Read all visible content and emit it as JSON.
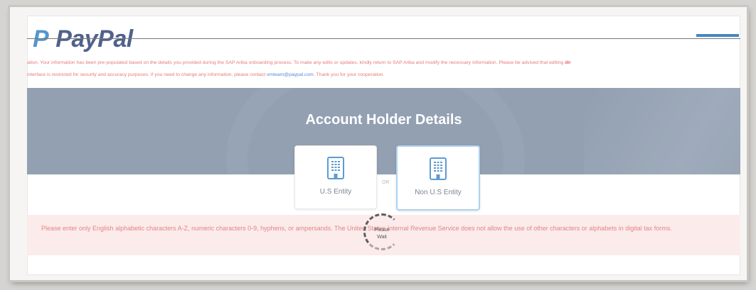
{
  "header": {
    "logo_text": "PayPal"
  },
  "notice": {
    "text_part1": "ation. Your information has been pre-populated based on the details you provided during the SAP Ariba onboarding process. To make any edits or updates, kindly return to SAP Ariba and modify the necessary information. Please be advised that editing",
    "text_strong": "dir",
    "text_part2": "interface is restricted for security and accuracy purposes. If you need to change any information, please contact",
    "email": "vmteam@paypal.com",
    "text_part3": ". Thank you for your cooperation."
  },
  "banner": {
    "title": "Account Holder Details"
  },
  "entity": {
    "us_label": "U.S Entity",
    "or_label": "OR",
    "nonus_label": "Non U.S Entity"
  },
  "warning": {
    "text": "Please enter only English alphabetic characters A-Z, numeric characters 0-9, hyphens, or ampersands. The United States Internal Revenue Service does not allow the use of other characters or alphabets in digital tax forms."
  },
  "spinner": {
    "line1": "Please",
    "line2": "Wait"
  },
  "colors": {
    "banner": "#7a8ba1",
    "notice_text": "#e25b5b",
    "warning_bg": "#fbe7e7",
    "accent_blue": "#1d6db4"
  },
  "icons": {
    "entity": "building-icon"
  }
}
